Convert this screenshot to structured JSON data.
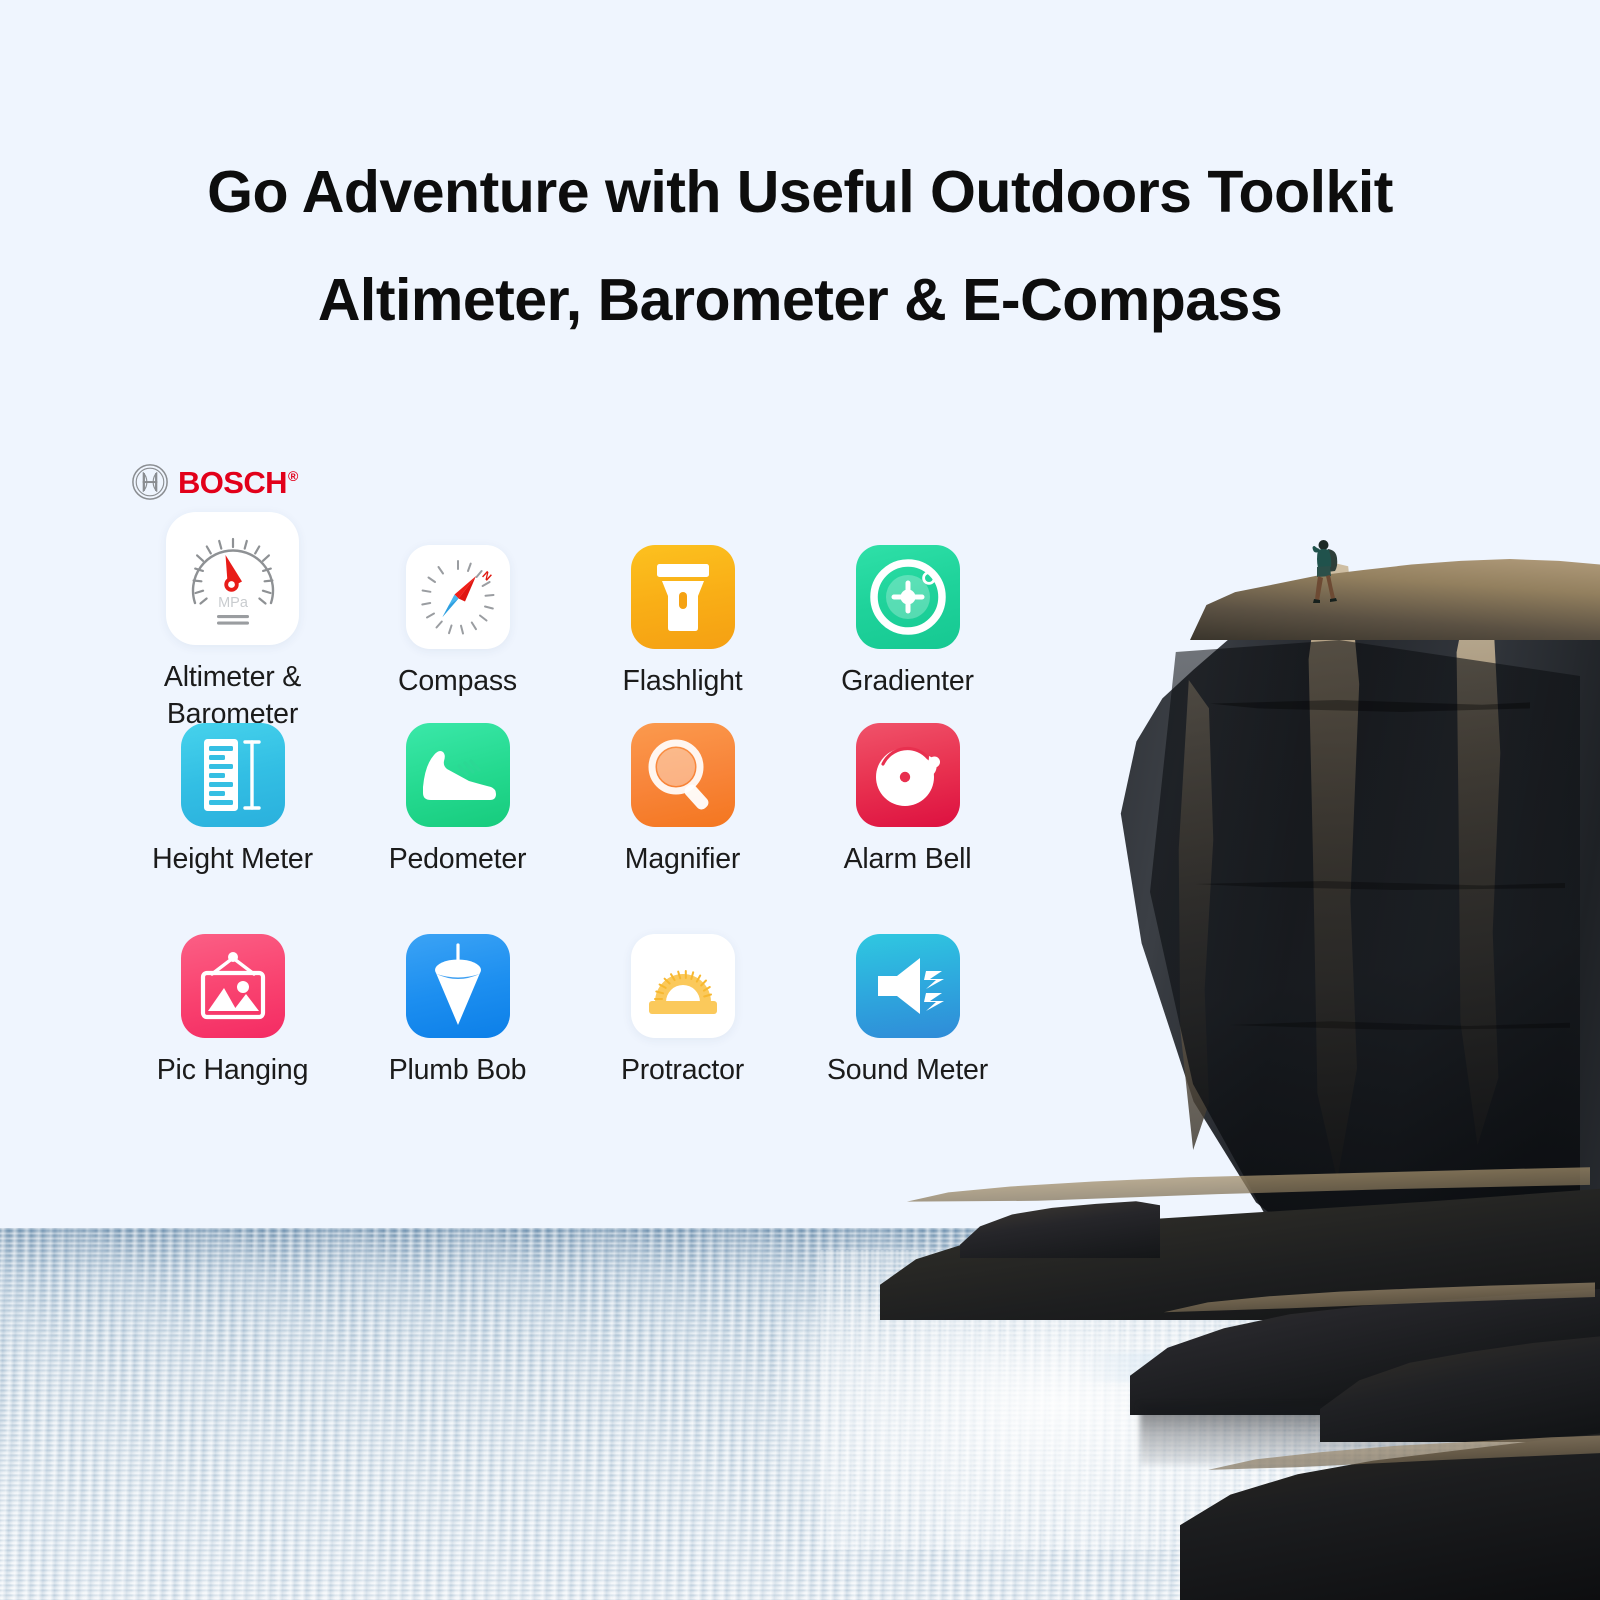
{
  "heading": {
    "line1": "Go Adventure with Useful Outdoors Toolkit",
    "line2": "Altimeter, Barometer & E-Compass"
  },
  "brand": {
    "name": "BOSCH",
    "registered": "®",
    "color": "#e2001a",
    "mark_icon": "bosch-armature-icon"
  },
  "background_color": "#eff5fe",
  "apps": [
    {
      "label": "Altimeter & Barometer",
      "icon": "gauge-barometer-icon",
      "tile_style": "bg-white",
      "tile_size": "large",
      "gauge_unit": "MPa",
      "accent": "#e81c18"
    },
    {
      "label": "Compass",
      "icon": "compass-icon",
      "tile_style": "bg-white",
      "tile_size": "small",
      "north_marker": "N",
      "accent": "#f01f18"
    },
    {
      "label": "Flashlight",
      "icon": "flashlight-icon",
      "tile_style": "bg-orange",
      "tile_size": "small",
      "accent": "#f9ae16"
    },
    {
      "label": "Gradienter",
      "icon": "bubble-level-target-icon",
      "tile_style": "bg-green",
      "tile_size": "small",
      "accent": "#1fd39b"
    },
    {
      "label": "Height Meter",
      "icon": "ruler-height-icon",
      "tile_style": "bg-cyan",
      "tile_size": "small",
      "accent": "#33bfe4"
    },
    {
      "label": "Pedometer",
      "icon": "sneaker-shoe-icon",
      "tile_style": "bg-mint",
      "tile_size": "small",
      "accent": "#24d98f"
    },
    {
      "label": "Magnifier",
      "icon": "magnifying-glass-icon",
      "tile_style": "bg-orange2",
      "tile_size": "small",
      "accent": "#f8853a"
    },
    {
      "label": "Alarm Bell",
      "icon": "alarm-bell-icon",
      "tile_style": "bg-crimson",
      "tile_size": "small",
      "accent": "#e8304f"
    },
    {
      "label": "Pic Hanging",
      "icon": "picture-frame-hanging-icon",
      "tile_style": "bg-pink",
      "tile_size": "small",
      "accent": "#f94370"
    },
    {
      "label": "Plumb Bob",
      "icon": "plumb-bob-icon",
      "tile_style": "bg-blue",
      "tile_size": "small",
      "accent": "#1d8ff0"
    },
    {
      "label": "Protractor",
      "icon": "protractor-icon",
      "tile_style": "bg-white",
      "tile_size": "small",
      "accent": "#f9c54d"
    },
    {
      "label": "Sound Meter",
      "icon": "speaker-sound-icon",
      "tile_style": "bg-sky",
      "tile_size": "small",
      "accent": "#2eaade"
    }
  ],
  "photo": {
    "description": "hiker-on-cliff-by-ocean",
    "elements": [
      "hiker-silhouette",
      "rock-cliff",
      "ocean-water",
      "sky"
    ]
  }
}
